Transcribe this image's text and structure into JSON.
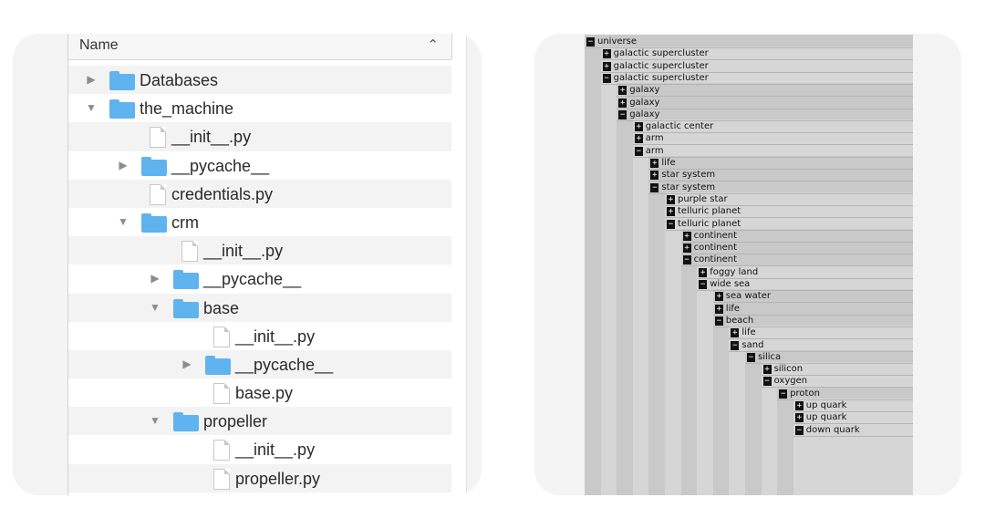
{
  "finder": {
    "column_header": "Name",
    "sort_icon": "chevron-up-icon",
    "rows": [
      {
        "label": "Databases",
        "type": "folder",
        "level": 0,
        "disclosure": "▶"
      },
      {
        "label": "the_machine",
        "type": "folder",
        "level": 0,
        "disclosure": "▼"
      },
      {
        "label": "__init__.py",
        "type": "file",
        "level": 1,
        "disclosure": ""
      },
      {
        "label": "__pycache__",
        "type": "folder",
        "level": 1,
        "disclosure": "▶"
      },
      {
        "label": "credentials.py",
        "type": "file",
        "level": 1,
        "disclosure": ""
      },
      {
        "label": "crm",
        "type": "folder",
        "level": 1,
        "disclosure": "▼"
      },
      {
        "label": "__init__.py",
        "type": "file",
        "level": 2,
        "disclosure": ""
      },
      {
        "label": "__pycache__",
        "type": "folder",
        "level": 2,
        "disclosure": "▶"
      },
      {
        "label": "base",
        "type": "folder",
        "level": 2,
        "disclosure": "▼"
      },
      {
        "label": "__init__.py",
        "type": "file",
        "level": 3,
        "disclosure": ""
      },
      {
        "label": "__pycache__",
        "type": "folder",
        "level": 3,
        "disclosure": "▶"
      },
      {
        "label": "base.py",
        "type": "file",
        "level": 3,
        "disclosure": ""
      },
      {
        "label": "propeller",
        "type": "folder",
        "level": 2,
        "disclosure": "▼"
      },
      {
        "label": "__init__.py",
        "type": "file",
        "level": 3,
        "disclosure": ""
      },
      {
        "label": "propeller.py",
        "type": "file",
        "level": 3,
        "disclosure": ""
      }
    ]
  },
  "tree": {
    "nodes": [
      {
        "label": "universe",
        "sign": "−",
        "depth": 0
      },
      {
        "label": "galactic supercluster",
        "sign": "+",
        "depth": 1
      },
      {
        "label": "galactic supercluster",
        "sign": "+",
        "depth": 1
      },
      {
        "label": "galactic supercluster",
        "sign": "−",
        "depth": 1
      },
      {
        "label": "galaxy",
        "sign": "+",
        "depth": 2
      },
      {
        "label": "galaxy",
        "sign": "+",
        "depth": 2
      },
      {
        "label": "galaxy",
        "sign": "−",
        "depth": 2
      },
      {
        "label": "galactic center",
        "sign": "+",
        "depth": 3
      },
      {
        "label": "arm",
        "sign": "+",
        "depth": 3
      },
      {
        "label": "arm",
        "sign": "−",
        "depth": 3
      },
      {
        "label": "life",
        "sign": "+",
        "depth": 4
      },
      {
        "label": "star system",
        "sign": "+",
        "depth": 4
      },
      {
        "label": "star system",
        "sign": "−",
        "depth": 4
      },
      {
        "label": "purple star",
        "sign": "+",
        "depth": 5
      },
      {
        "label": "telluric planet",
        "sign": "+",
        "depth": 5
      },
      {
        "label": "telluric planet",
        "sign": "−",
        "depth": 5
      },
      {
        "label": "continent",
        "sign": "+",
        "depth": 6
      },
      {
        "label": "continent",
        "sign": "+",
        "depth": 6
      },
      {
        "label": "continent",
        "sign": "−",
        "depth": 6
      },
      {
        "label": "foggy land",
        "sign": "+",
        "depth": 7
      },
      {
        "label": "wide sea",
        "sign": "−",
        "depth": 7
      },
      {
        "label": "sea water",
        "sign": "+",
        "depth": 8
      },
      {
        "label": "life",
        "sign": "+",
        "depth": 8
      },
      {
        "label": "beach",
        "sign": "−",
        "depth": 8
      },
      {
        "label": "life",
        "sign": "+",
        "depth": 9
      },
      {
        "label": "sand",
        "sign": "−",
        "depth": 9
      },
      {
        "label": "silica",
        "sign": "−",
        "depth": 10
      },
      {
        "label": "silicon",
        "sign": "+",
        "depth": 11
      },
      {
        "label": "oxygen",
        "sign": "−",
        "depth": 11
      },
      {
        "label": "proton",
        "sign": "−",
        "depth": 12
      },
      {
        "label": "up quark",
        "sign": "+",
        "depth": 13
      },
      {
        "label": "up quark",
        "sign": "+",
        "depth": 13
      },
      {
        "label": "down quark",
        "sign": "−",
        "depth": 13
      }
    ]
  },
  "colors": {
    "folder": "#5fb3ee",
    "card_background": "#f4f4f4",
    "stripe": "#f3f3f3",
    "tree_box": "#111111"
  }
}
